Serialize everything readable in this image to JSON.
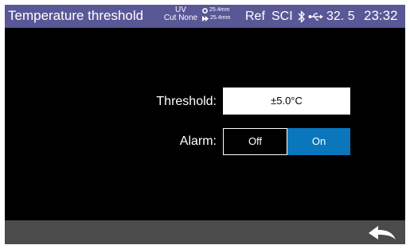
{
  "status_bar": {
    "title": "Temperature threshold",
    "uv_label": "UV",
    "cut_label": "Cut None",
    "fiber_left": "25.4mm",
    "fiber_right": "25.4mm",
    "ref": "Ref",
    "sci": "SCI",
    "battery_value": "32. 5",
    "clock": "23:32"
  },
  "settings": {
    "threshold_label": "Threshold:",
    "threshold_value": "±5.0°C",
    "alarm_label": "Alarm:",
    "alarm_off": "Off",
    "alarm_on": "On",
    "alarm_selected": "On"
  },
  "icons": {
    "bluetooth": "bluetooth-icon",
    "usb": "usb-icon",
    "back": "back-arrow-icon"
  },
  "colors": {
    "status_bar_bg": "#5a5796",
    "selected_option_bg": "#0a77bd",
    "bottom_bar_bg": "#4b4b4b"
  }
}
